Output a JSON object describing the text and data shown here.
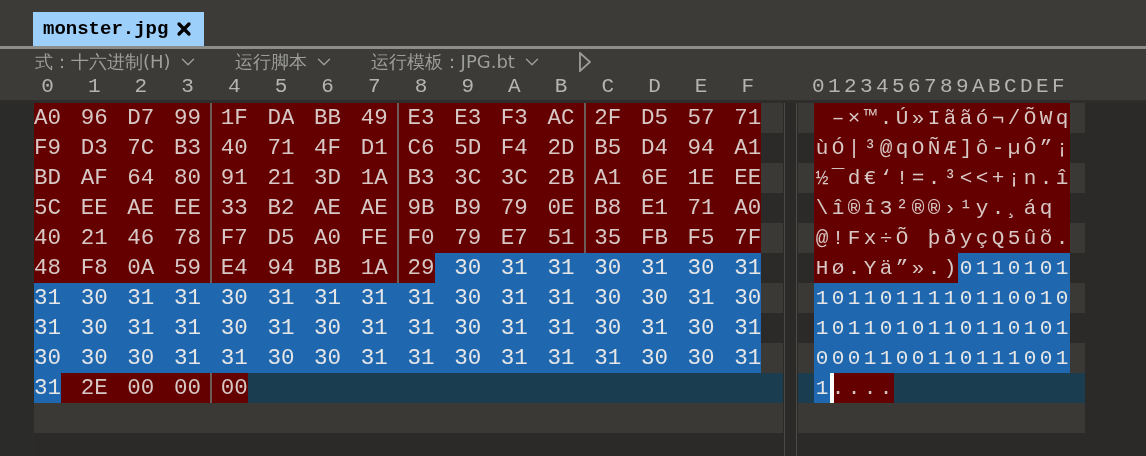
{
  "tab": {
    "title": "monster.jpg",
    "selected": true
  },
  "toolbar": {
    "dropdowns": [
      {
        "label": "式：十六进制(H)"
      },
      {
        "label": "运行脚本"
      },
      {
        "label": "运行模板：JPG.bt"
      }
    ]
  },
  "hex_header": [
    "0",
    "1",
    "2",
    "3",
    "4",
    "5",
    "6",
    "7",
    "8",
    "9",
    "A",
    "B",
    "C",
    "D",
    "E",
    "F"
  ],
  "text_header": "0123456789ABCDEF",
  "rows": [
    {
      "current": false,
      "cells": [
        {
          "hex": "A0",
          "selected": false
        },
        {
          "hex": "96",
          "char": "–",
          "selected": false
        },
        {
          "hex": "D7",
          "char": "×",
          "selected": false
        },
        {
          "hex": "99",
          "char": "™",
          "selected": false
        },
        {
          "hex": "1F",
          "char": ".",
          "selected": false
        },
        {
          "hex": "DA",
          "char": "Ú",
          "selected": false
        },
        {
          "hex": "BB",
          "char": "»",
          "selected": false
        },
        {
          "hex": "49",
          "char": "I",
          "selected": false
        },
        {
          "hex": "E3",
          "char": "ã",
          "selected": false
        },
        {
          "hex": "E3",
          "char": "ã",
          "selected": false
        },
        {
          "hex": "F3",
          "char": "ó",
          "selected": false
        },
        {
          "hex": "AC",
          "char": "¬",
          "selected": false
        },
        {
          "hex": "2F",
          "char": "/",
          "selected": false
        },
        {
          "hex": "D5",
          "char": "Õ",
          "selected": false
        },
        {
          "hex": "57",
          "char": "W",
          "selected": false
        },
        {
          "hex": "71",
          "char": "q",
          "selected": false
        }
      ]
    },
    {
      "current": false,
      "cells": [
        {
          "hex": "F9",
          "char": "ù",
          "selected": false
        },
        {
          "hex": "D3",
          "char": "Ó",
          "selected": false
        },
        {
          "hex": "7C",
          "char": "|",
          "selected": false
        },
        {
          "hex": "B3",
          "char": "³",
          "selected": false
        },
        {
          "hex": "40",
          "char": "@",
          "selected": false
        },
        {
          "hex": "71",
          "char": "q",
          "selected": false
        },
        {
          "hex": "4F",
          "char": "O",
          "selected": false
        },
        {
          "hex": "D1",
          "char": "Ñ",
          "selected": false
        },
        {
          "hex": "C6",
          "char": "Æ",
          "selected": false
        },
        {
          "hex": "5D",
          "char": "]",
          "selected": false
        },
        {
          "hex": "F4",
          "char": "ô",
          "selected": false
        },
        {
          "hex": "2D",
          "char": "-",
          "selected": false
        },
        {
          "hex": "B5",
          "char": "µ",
          "selected": false
        },
        {
          "hex": "D4",
          "char": "Ô",
          "selected": false
        },
        {
          "hex": "94",
          "char": "”",
          "selected": false
        },
        {
          "hex": "A1",
          "char": "¡",
          "selected": false
        }
      ]
    },
    {
      "current": false,
      "cells": [
        {
          "hex": "BD",
          "char": "½",
          "selected": false
        },
        {
          "hex": "AF",
          "char": "¯",
          "selected": false
        },
        {
          "hex": "64",
          "char": "d",
          "selected": false
        },
        {
          "hex": "80",
          "char": "€",
          "selected": false
        },
        {
          "hex": "91",
          "char": "‘",
          "selected": false
        },
        {
          "hex": "21",
          "char": "!",
          "selected": false
        },
        {
          "hex": "3D",
          "char": "=",
          "selected": false
        },
        {
          "hex": "1A",
          "char": ".",
          "selected": false
        },
        {
          "hex": "B3",
          "char": "³",
          "selected": false
        },
        {
          "hex": "3C",
          "char": "<",
          "selected": false
        },
        {
          "hex": "3C",
          "char": "<",
          "selected": false
        },
        {
          "hex": "2B",
          "char": "+",
          "selected": false
        },
        {
          "hex": "A1",
          "char": "¡",
          "selected": false
        },
        {
          "hex": "6E",
          "char": "n",
          "selected": false
        },
        {
          "hex": "1E",
          "char": ".",
          "selected": false
        },
        {
          "hex": "EE",
          "char": "î",
          "selected": false
        }
      ]
    },
    {
      "current": false,
      "cells": [
        {
          "hex": "5C",
          "char": "\\",
          "selected": false
        },
        {
          "hex": "EE",
          "char": "î",
          "selected": false
        },
        {
          "hex": "AE",
          "char": "®",
          "selected": false
        },
        {
          "hex": "EE",
          "char": "î",
          "selected": false
        },
        {
          "hex": "33",
          "char": "3",
          "selected": false
        },
        {
          "hex": "B2",
          "char": "²",
          "selected": false
        },
        {
          "hex": "AE",
          "char": "®",
          "selected": false
        },
        {
          "hex": "AE",
          "char": "®",
          "selected": false
        },
        {
          "hex": "9B",
          "char": "›",
          "selected": false
        },
        {
          "hex": "B9",
          "char": "¹",
          "selected": false
        },
        {
          "hex": "79",
          "char": "y",
          "selected": false
        },
        {
          "hex": "0E",
          "char": ".",
          "selected": false
        },
        {
          "hex": "B8",
          "char": "¸",
          "selected": false
        },
        {
          "hex": "E1",
          "char": "á",
          "selected": false
        },
        {
          "hex": "71",
          "char": "q",
          "selected": false
        },
        {
          "hex": "A0",
          "selected": false
        }
      ]
    },
    {
      "current": false,
      "cells": [
        {
          "hex": "40",
          "char": "@",
          "selected": false
        },
        {
          "hex": "21",
          "char": "!",
          "selected": false
        },
        {
          "hex": "46",
          "char": "F",
          "selected": false
        },
        {
          "hex": "78",
          "char": "x",
          "selected": false
        },
        {
          "hex": "F7",
          "char": "÷",
          "selected": false
        },
        {
          "hex": "D5",
          "char": "Õ",
          "selected": false
        },
        {
          "hex": "A0",
          "selected": false
        },
        {
          "hex": "FE",
          "char": "þ",
          "selected": false
        },
        {
          "hex": "F0",
          "char": "ð",
          "selected": false
        },
        {
          "hex": "79",
          "char": "y",
          "selected": false
        },
        {
          "hex": "E7",
          "char": "ç",
          "selected": false
        },
        {
          "hex": "51",
          "char": "Q",
          "selected": false
        },
        {
          "hex": "35",
          "char": "5",
          "selected": false
        },
        {
          "hex": "FB",
          "char": "û",
          "selected": false
        },
        {
          "hex": "F5",
          "char": "õ",
          "selected": false
        },
        {
          "hex": "7F",
          "char": ".",
          "selected": false
        }
      ]
    },
    {
      "current": false,
      "cells": [
        {
          "hex": "48",
          "char": "H",
          "selected": false
        },
        {
          "hex": "F8",
          "char": "ø",
          "selected": false
        },
        {
          "hex": "0A",
          "char": ".",
          "selected": false
        },
        {
          "hex": "59",
          "char": "Y",
          "selected": false
        },
        {
          "hex": "E4",
          "char": "ä",
          "selected": false
        },
        {
          "hex": "94",
          "char": "”",
          "selected": false
        },
        {
          "hex": "BB",
          "char": "»",
          "selected": false
        },
        {
          "hex": "1A",
          "char": ".",
          "selected": false
        },
        {
          "hex": "29",
          "char": ")",
          "selected": false
        },
        {
          "hex": "30",
          "char": "0",
          "selected": true
        },
        {
          "hex": "31",
          "char": "1",
          "selected": true
        },
        {
          "hex": "31",
          "char": "1",
          "selected": true
        },
        {
          "hex": "30",
          "char": "0",
          "selected": true
        },
        {
          "hex": "31",
          "char": "1",
          "selected": true
        },
        {
          "hex": "30",
          "char": "0",
          "selected": true
        },
        {
          "hex": "31",
          "char": "1",
          "selected": true
        }
      ]
    },
    {
      "current": false,
      "cells": [
        {
          "hex": "31",
          "char": "1",
          "selected": true
        },
        {
          "hex": "30",
          "char": "0",
          "selected": true
        },
        {
          "hex": "31",
          "char": "1",
          "selected": true
        },
        {
          "hex": "31",
          "char": "1",
          "selected": true
        },
        {
          "hex": "30",
          "char": "0",
          "selected": true
        },
        {
          "hex": "31",
          "char": "1",
          "selected": true
        },
        {
          "hex": "31",
          "char": "1",
          "selected": true
        },
        {
          "hex": "31",
          "char": "1",
          "selected": true
        },
        {
          "hex": "31",
          "char": "1",
          "selected": true
        },
        {
          "hex": "30",
          "char": "0",
          "selected": true
        },
        {
          "hex": "31",
          "char": "1",
          "selected": true
        },
        {
          "hex": "31",
          "char": "1",
          "selected": true
        },
        {
          "hex": "30",
          "char": "0",
          "selected": true
        },
        {
          "hex": "30",
          "char": "0",
          "selected": true
        },
        {
          "hex": "31",
          "char": "1",
          "selected": true
        },
        {
          "hex": "30",
          "char": "0",
          "selected": true
        }
      ]
    },
    {
      "current": false,
      "cells": [
        {
          "hex": "31",
          "char": "1",
          "selected": true
        },
        {
          "hex": "30",
          "char": "0",
          "selected": true
        },
        {
          "hex": "31",
          "char": "1",
          "selected": true
        },
        {
          "hex": "31",
          "char": "1",
          "selected": true
        },
        {
          "hex": "30",
          "char": "0",
          "selected": true
        },
        {
          "hex": "31",
          "char": "1",
          "selected": true
        },
        {
          "hex": "30",
          "char": "0",
          "selected": true
        },
        {
          "hex": "31",
          "char": "1",
          "selected": true
        },
        {
          "hex": "31",
          "char": "1",
          "selected": true
        },
        {
          "hex": "30",
          "char": "0",
          "selected": true
        },
        {
          "hex": "31",
          "char": "1",
          "selected": true
        },
        {
          "hex": "31",
          "char": "1",
          "selected": true
        },
        {
          "hex": "30",
          "char": "0",
          "selected": true
        },
        {
          "hex": "31",
          "char": "1",
          "selected": true
        },
        {
          "hex": "30",
          "char": "0",
          "selected": true
        },
        {
          "hex": "31",
          "char": "1",
          "selected": true
        }
      ]
    },
    {
      "current": false,
      "cells": [
        {
          "hex": "30",
          "char": "0",
          "selected": true
        },
        {
          "hex": "30",
          "char": "0",
          "selected": true
        },
        {
          "hex": "30",
          "char": "0",
          "selected": true
        },
        {
          "hex": "31",
          "char": "1",
          "selected": true
        },
        {
          "hex": "31",
          "char": "1",
          "selected": true
        },
        {
          "hex": "30",
          "char": "0",
          "selected": true
        },
        {
          "hex": "30",
          "char": "0",
          "selected": true
        },
        {
          "hex": "31",
          "char": "1",
          "selected": true
        },
        {
          "hex": "31",
          "char": "1",
          "selected": true
        },
        {
          "hex": "30",
          "char": "0",
          "selected": true
        },
        {
          "hex": "31",
          "char": "1",
          "selected": true
        },
        {
          "hex": "31",
          "char": "1",
          "selected": true
        },
        {
          "hex": "31",
          "char": "1",
          "selected": true
        },
        {
          "hex": "30",
          "char": "0",
          "selected": true
        },
        {
          "hex": "30",
          "char": "0",
          "selected": true
        },
        {
          "hex": "31",
          "char": "1",
          "selected": true
        }
      ]
    },
    {
      "current": true,
      "cells": [
        {
          "hex": "31",
          "char": "1",
          "selected": true
        },
        {
          "hex": "2E",
          "char": ".",
          "selected": false,
          "cursor": true
        },
        {
          "hex": "00",
          "char": ".",
          "selected": false
        },
        {
          "hex": "00",
          "char": ".",
          "selected": false
        },
        {
          "hex": "00",
          "char": ".",
          "selected": false
        }
      ]
    }
  ]
}
